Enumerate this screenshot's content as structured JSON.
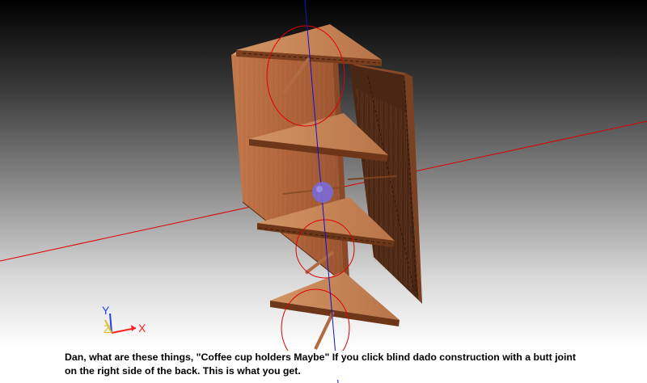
{
  "caption": {
    "text": "Dan, what are these things, \"Coffee cup holders Maybe\" If you click blind dado construction with a butt joint\non the right side of the back. This is what you get."
  },
  "axis_triad": {
    "x_label": "X",
    "y_label": "Y",
    "z_label": "Z",
    "x_color": "#ff2020",
    "y_color": "#2040ff",
    "z_color": "#e0c020"
  },
  "colors": {
    "wood": "#b8683e",
    "wood_dark": "#7a3e1e",
    "red_axis": "#e00000",
    "blue_axis": "#1010d0",
    "rotation_gizmo": "#7a6ad8"
  }
}
